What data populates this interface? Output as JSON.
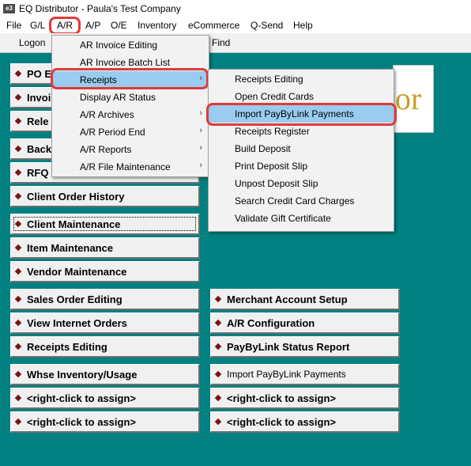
{
  "window": {
    "title": "EQ Distributor - Paula's Test Company",
    "icon_text": "e3"
  },
  "menubar": [
    "File",
    "G/L",
    "A/R",
    "A/P",
    "O/E",
    "Inventory",
    "eCommerce",
    "Q-Send",
    "Help"
  ],
  "toolbar": {
    "logon": "Logon",
    "find": "Find"
  },
  "ar_menu": {
    "items": [
      {
        "label": "AR Invoice Editing",
        "submenu": false
      },
      {
        "label": "AR Invoice Batch List",
        "submenu": false
      },
      {
        "label": "Receipts",
        "submenu": true
      },
      {
        "label": "Display AR Status",
        "submenu": false
      },
      {
        "label": "A/R Archives",
        "submenu": true
      },
      {
        "label": "A/R Period End",
        "submenu": true
      },
      {
        "label": "A/R Reports",
        "submenu": true
      },
      {
        "label": "A/R File Maintenance",
        "submenu": true
      }
    ],
    "arrow_glyph": "›"
  },
  "receipts_submenu": {
    "items": [
      "Receipts Editing",
      "Open Credit Cards",
      "Import PayByLink Payments",
      "Receipts Register",
      "Build Deposit",
      "Print Deposit Slip",
      "Unpost Deposit Slip",
      "Search Credit Card Charges",
      "Validate Gift Certificate"
    ]
  },
  "left_buttons": [
    "PO E",
    "Invoi",
    "Rele",
    "Back",
    "RFQ",
    "Client Order History",
    "Client Maintenance",
    "Item Maintenance",
    "Vendor Maintenance",
    "Sales Order Editing",
    "View Internet Orders",
    "Receipts Editing",
    "Whse Inventory/Usage",
    "<right-click to assign>",
    "<right-click to assign>"
  ],
  "right_buttons": [
    "Merchant Account Setup",
    "A/R Configuration",
    "PayByLink Status Report",
    "Import PayByLink Payments",
    "<right-click to assign>",
    "<right-click to assign>"
  ],
  "logo_text": "or",
  "colors": {
    "background": "#008080",
    "highlight_ring": "#e03a3a",
    "selected": "#99ccee",
    "diamond": "#7a1414"
  }
}
